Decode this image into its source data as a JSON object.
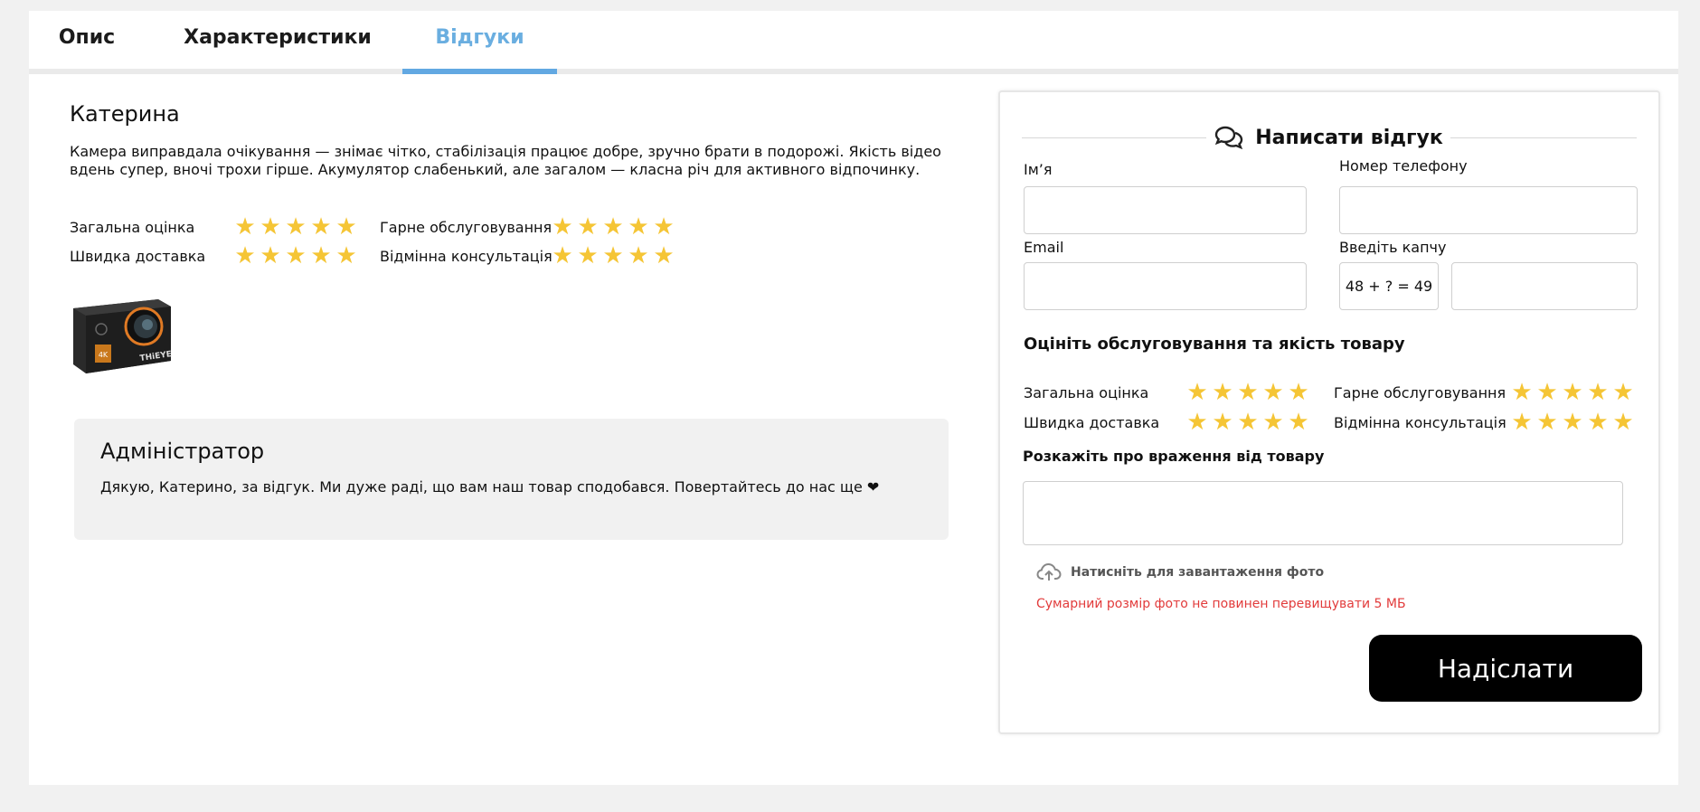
{
  "tabs": [
    {
      "label": "Опис"
    },
    {
      "label": "Характеристики"
    },
    {
      "label": "Відгуки"
    }
  ],
  "review": {
    "name": "Катерина",
    "text": "Камера виправдала очікування — знімає чітко, стабілізація працює добре, зручно брати в подорожі. Якість відео вдень супер, вночі трохи гірше. Акумулятор слабенький, але загалом — класна річ для активного відпочинку.",
    "ratings": [
      {
        "label": "Загальна оцінка",
        "stars": 5
      },
      {
        "label": "Гарне обслуговування",
        "stars": 5
      },
      {
        "label": "Швидка доставка",
        "stars": 5
      },
      {
        "label": "Відмінна консультація",
        "stars": 5
      }
    ],
    "product_brand": "THiEYE",
    "product_badge": "4K"
  },
  "admin_reply": {
    "name": "Адміністратор",
    "text": "Дякую, Катерино, за відгук. Ми дуже раді, що вам наш товар сподобався. Повертайтесь до нас ще ❤"
  },
  "form": {
    "title": "Написати відгук",
    "name_label": "Ім’я",
    "phone_label": "Номер телефону",
    "email_label": "Email",
    "captcha_label": "Введіть капчу",
    "captcha_question": "48 + ? = 49",
    "rate_title": "Оцініть обслуговування та якість товару",
    "ratings": [
      {
        "label": "Загальна оцінка",
        "stars": 5
      },
      {
        "label": "Гарне обслуговування",
        "stars": 5
      },
      {
        "label": "Швидка доставка",
        "stars": 5
      },
      {
        "label": "Відмінна консультація",
        "stars": 5
      }
    ],
    "story_label": "Розкажіть про враження від товару",
    "upload_label": "Натисніть для завантаження фото",
    "size_warning": "Сумарний розмір фото не повинен перевищувати 5 МБ",
    "submit_label": "Надіслати"
  },
  "colors": {
    "accent": "#62a8e2",
    "star": "#f5c535",
    "warning": "#e23b3b",
    "button": "#000000"
  }
}
